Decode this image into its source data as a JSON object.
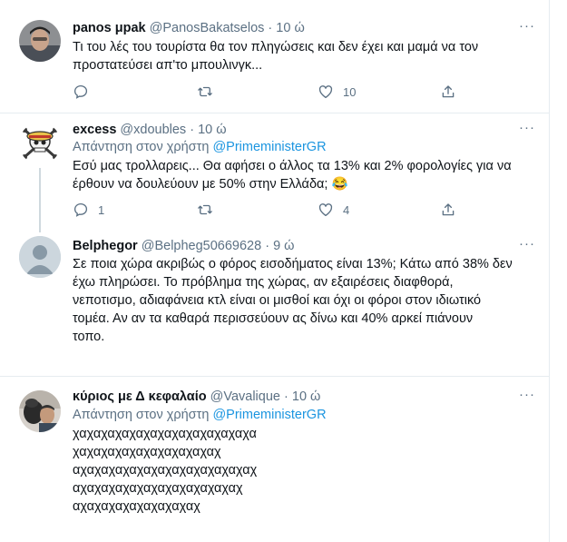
{
  "tweets": [
    {
      "name": "panos μpak",
      "handle": "@PanosBakatselos",
      "dot": "·",
      "time": "10 ώ",
      "lines": [
        "Τι του λές του τουρίστα θα τον πληγώσεις και δεν έχει και μαμά να τον",
        "προστατεύσει απ'το μπουλινγκ..."
      ],
      "replies": "",
      "retweets": "",
      "likes": "10"
    },
    {
      "name": "excess",
      "handle": "@xdoubles",
      "dot": "·",
      "time": "10 ώ",
      "reply_prefix": "Απάντηση στον χρήστη",
      "reply_to": "@PrimeministerGR",
      "lines": [
        "Εσύ μας τρολλαρεις... Θα αφήσει ο άλλος τα 13% και 2% φορολογίες για να",
        "έρθουν να δουλεύουν με 50% στην Ελλάδα; 😂"
      ],
      "replies": "1",
      "retweets": "",
      "likes": "4"
    },
    {
      "name": "Belphegor",
      "handle": "@Belpheg50669628",
      "dot": "·",
      "time": "9 ώ",
      "lines": [
        "Σε ποια χώρα ακριβώς ο φόρος εισοδήματος είναι 13%; Κάτω από 38% δεν",
        "έχω πληρώσει. Το πρόβλημα της χώρας, αν εξαιρέσεις διαφθορά,",
        "νεποτισμο, αδιαφάνεια κτλ είναι οι μισθοί και όχι οι φόροι στον ιδιωτικό",
        "τομέα. Αν αν τα καθαρά περισσεύουν ας δίνω και 40% αρκεί πιάνουν",
        "τοπο."
      ]
    },
    {
      "name": "κύριος με Δ κεφαλαίο",
      "handle": "@Vavalique",
      "dot": "·",
      "time": "10 ώ",
      "reply_prefix": "Απάντηση στον χρήστη",
      "reply_to": "@PrimeministerGR",
      "lines": [
        "χαχαχαχαχαχαχαχαχαχαχαχαχα",
        "χαχαχαχαχαχαχαχαχαχαχ",
        "αχαχαχαχαχαχαχαχαχαχαχαχαχ",
        "αχαχαχαχαχαχαχαχαχαχαχαχ",
        "αχαχαχαχαχαχαχαχαχ"
      ]
    }
  ],
  "icons": {
    "reply": "reply-icon",
    "retweet": "retweet-icon",
    "like": "like-icon",
    "share": "share-icon",
    "more": "more-icon"
  },
  "colors": {
    "muted": "#5b7083",
    "mention": "#1b95e0",
    "border": "#e6ecf0"
  }
}
